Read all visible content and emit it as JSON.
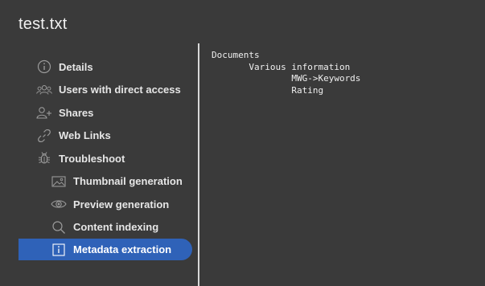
{
  "dialog": {
    "title": "test.txt"
  },
  "sidebar": {
    "items": [
      {
        "label": "Details",
        "icon": "info-circle-icon"
      },
      {
        "label": "Users with direct access",
        "icon": "users-icon"
      },
      {
        "label": "Shares",
        "icon": "add-user-icon"
      },
      {
        "label": "Web Links",
        "icon": "link-icon"
      },
      {
        "label": "Troubleshoot",
        "icon": "bug-icon"
      },
      {
        "label": "Thumbnail generation",
        "icon": "image-icon"
      },
      {
        "label": "Preview generation",
        "icon": "eye-icon"
      },
      {
        "label": "Content indexing",
        "icon": "search-icon"
      },
      {
        "label": "Metadata extraction",
        "icon": "info-box-icon"
      }
    ],
    "active_item": "Metadata extraction",
    "active_color": "#2f62b8"
  },
  "metadata": {
    "lines": [
      "Documents",
      "       Various information",
      "               MWG->Keywords",
      "               Rating"
    ]
  }
}
